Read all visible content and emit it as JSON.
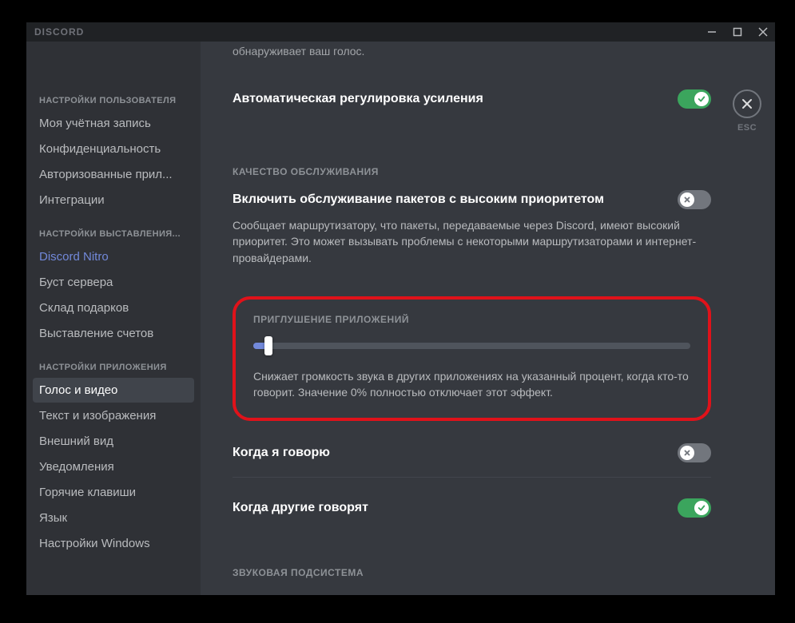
{
  "titlebar": {
    "brand": "DISCORD"
  },
  "esc": {
    "label": "ESC"
  },
  "sidebar": {
    "section_user": "НАСТРОЙКИ ПОЛЬЗОВАТЕЛЯ",
    "user_items": [
      "Моя учётная запись",
      "Конфиденциальность",
      "Авторизованные прил...",
      "Интеграции"
    ],
    "section_billing": "НАСТРОЙКИ ВЫСТАВЛЕНИЯ...",
    "billing_items": [
      "Discord Nitro",
      "Буст сервера",
      "Склад подарков",
      "Выставление счетов"
    ],
    "section_app": "НАСТРОЙКИ ПРИЛОЖЕНИЯ",
    "app_items": [
      "Голос и видео",
      "Текст и изображения",
      "Внешний вид",
      "Уведомления",
      "Горячие клавиши",
      "Язык",
      "Настройки Windows"
    ]
  },
  "content": {
    "partial_desc": "обнаруживает ваш голос.",
    "agc": {
      "title": "Автоматическая регулировка усиления",
      "on": true
    },
    "qos": {
      "header": "КАЧЕСТВО ОБСЛУЖИВАНИЯ",
      "title": "Включить обслуживание пакетов с высоким приоритетом",
      "desc": "Сообщает маршрутизатору, что пакеты, передаваемые через Discord, имеют высокий приоритет. Это может вызывать проблемы с некоторыми маршрутизаторами и интернет-провайдерами.",
      "on": false
    },
    "attenuation": {
      "header": "ПРИГЛУШЕНИЕ ПРИЛОЖЕНИЙ",
      "desc": "Снижает громкость звука в других приложениях на указанный процент, когда кто-то говорит. Значение 0% полностью отключает этот эффект.",
      "value_percent": 3
    },
    "when_i_speak": {
      "title": "Когда я говорю",
      "on": false
    },
    "when_others_speak": {
      "title": "Когда другие говорят",
      "on": true
    },
    "subsystem": {
      "header": "ЗВУКОВАЯ ПОДСИСТЕМА"
    }
  }
}
